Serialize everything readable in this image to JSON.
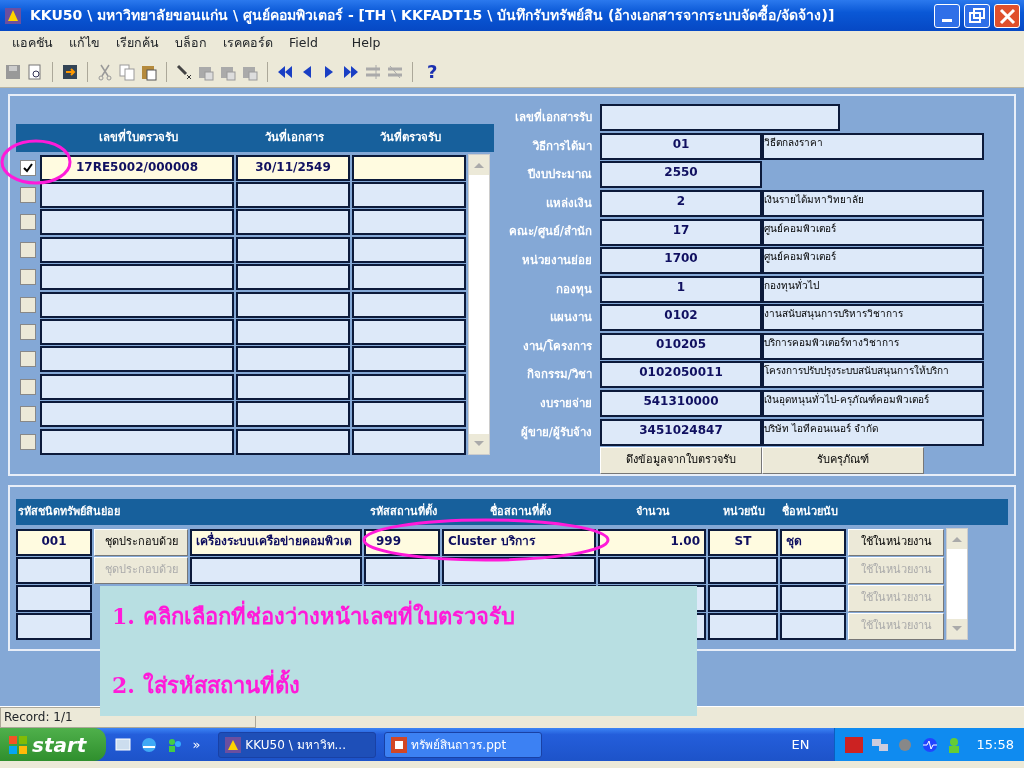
{
  "window": {
    "title": "KKU50 \\ มหาวิทยาลัยขอนแก่น \\ ศูนย์คอมพิวเตอร์ - [TH \\ KKFADT15 \\ บันทึกรับทรัพย์สิน (อ้างเอกสารจากระบบจัดซื้อ/จัดจ้าง)]"
  },
  "menu": [
    "แอคชัน",
    "แก้ไข",
    "เรียกค้น",
    "บล็อก",
    "เรคคอร์ด",
    "Field",
    "Help"
  ],
  "toolbar": {
    "help": "?"
  },
  "receipt_table": {
    "columns": [
      "เลขที่ใบตรวจรับ",
      "วันที่เอกสาร",
      "วันที่ตรวจรับ"
    ],
    "rows": [
      {
        "checked": true,
        "current": true,
        "cells": [
          "17RE5002/000008",
          "30/11/2549"
        ]
      },
      {
        "checked": false,
        "current": false
      },
      {
        "checked": false,
        "current": false
      },
      {
        "checked": false,
        "current": false
      },
      {
        "checked": false,
        "current": false
      },
      {
        "checked": false,
        "current": false
      },
      {
        "checked": false,
        "current": false
      },
      {
        "checked": false,
        "current": false
      },
      {
        "checked": false,
        "current": false
      },
      {
        "checked": false,
        "current": false
      },
      {
        "checked": false,
        "current": false
      }
    ]
  },
  "form": {
    "fields": [
      {
        "kind": "wide",
        "label": "เลขที่เอกสารรับ"
      },
      {
        "kind": "code_name",
        "label": "วิธีการได้มา",
        "code": "01",
        "name": "วิธีตกลงราคา"
      },
      {
        "kind": "code",
        "label": "ปีงบประมาณ",
        "code": "2550"
      },
      {
        "kind": "code_name",
        "label": "แหล่งเงิน",
        "code": "2",
        "name": "เงินรายได้มหาวิทยาลัย"
      },
      {
        "kind": "code_name",
        "label": "คณะ/ศูนย์/สำนัก",
        "code": "17",
        "name": "ศูนย์คอมพิวเตอร์"
      },
      {
        "kind": "code_name",
        "label": "หน่วยงานย่อย",
        "code": "1700",
        "name": "ศูนย์คอมพิวเตอร์"
      },
      {
        "kind": "code_name",
        "label": "กองทุน",
        "code": "1",
        "name": "กองทุนทั่วไป"
      },
      {
        "kind": "code_name",
        "label": "แผนงาน",
        "code": "0102",
        "name": "งานสนับสนุนการบริหารวิชาการ"
      },
      {
        "kind": "code_name",
        "label": "งาน/โครงการ",
        "code": "010205",
        "name": "บริการคอมพิวเตอร์ทางวิชาการ"
      },
      {
        "kind": "code_name",
        "label": "กิจกรรม/วิชา",
        "code": "0102050011",
        "name": "โครงการปรับปรุงระบบสนับสนุนการให้บริกา"
      },
      {
        "kind": "code_name",
        "label": "งบรายจ่าย",
        "code": "541310000",
        "name": "เงินอุดหนุนทั่วไป-ครุภัณฑ์คอมพิวเตอร์"
      },
      {
        "kind": "code_name",
        "label": "ผู้ขาย/ผู้รับจ้าง",
        "code": "3451024847",
        "name": "บริษัท ไอทีคอนเนอร์ จำกัด"
      }
    ],
    "buttons": [
      "ดึงข้อมูลจากใบตรวจรับ",
      "รับครุภัณฑ์"
    ]
  },
  "asset_table": {
    "columns": [
      "รหัสชนิดทรัพย์สินย่อย",
      "รหัสสถานที่ตั้ง",
      "ชื่อสถานที่ตั้ง",
      "จำนวน",
      "หน่วยนับ",
      "ชื่อหน่วยนับ"
    ],
    "rows": [
      {
        "current": true,
        "code": "001",
        "parts_button": "ชุดประกอบด้วย",
        "description": "เครื่องระบบเครือข่ายคอมพิวเต",
        "location_code": "999",
        "location_name": "Cluster บริการ",
        "quantity": "1.00",
        "unit": "ST",
        "unit_name": "ชุด",
        "use_button": "ใช้ในหน่วยงาน"
      },
      {
        "current": false,
        "parts_button": "ชุดประกอบด้วย",
        "use_button": "ใช้ในหน่วยงาน"
      },
      {
        "current": false,
        "use_button": "ใช้ในหน่วยงาน"
      },
      {
        "current": false,
        "use_button": "ใช้ในหน่วยงาน"
      }
    ]
  },
  "callout": [
    "1. คลิกเลือกที่ช่องว่างหน้าเลขที่ใบตรวจรับ",
    "2. ใส่รหัสสถานที่ตั้ง"
  ],
  "status_bar": {
    "record": "Record: 1/1"
  },
  "taskbar": {
    "start": "start",
    "more": "»",
    "tasks": [
      {
        "label": "KKU50 \\ มหาวิท...",
        "selected": true
      },
      {
        "label": "ทรัพย์สินถาวร.ppt",
        "selected": false
      }
    ],
    "language": "EN",
    "clock": "15:58"
  }
}
